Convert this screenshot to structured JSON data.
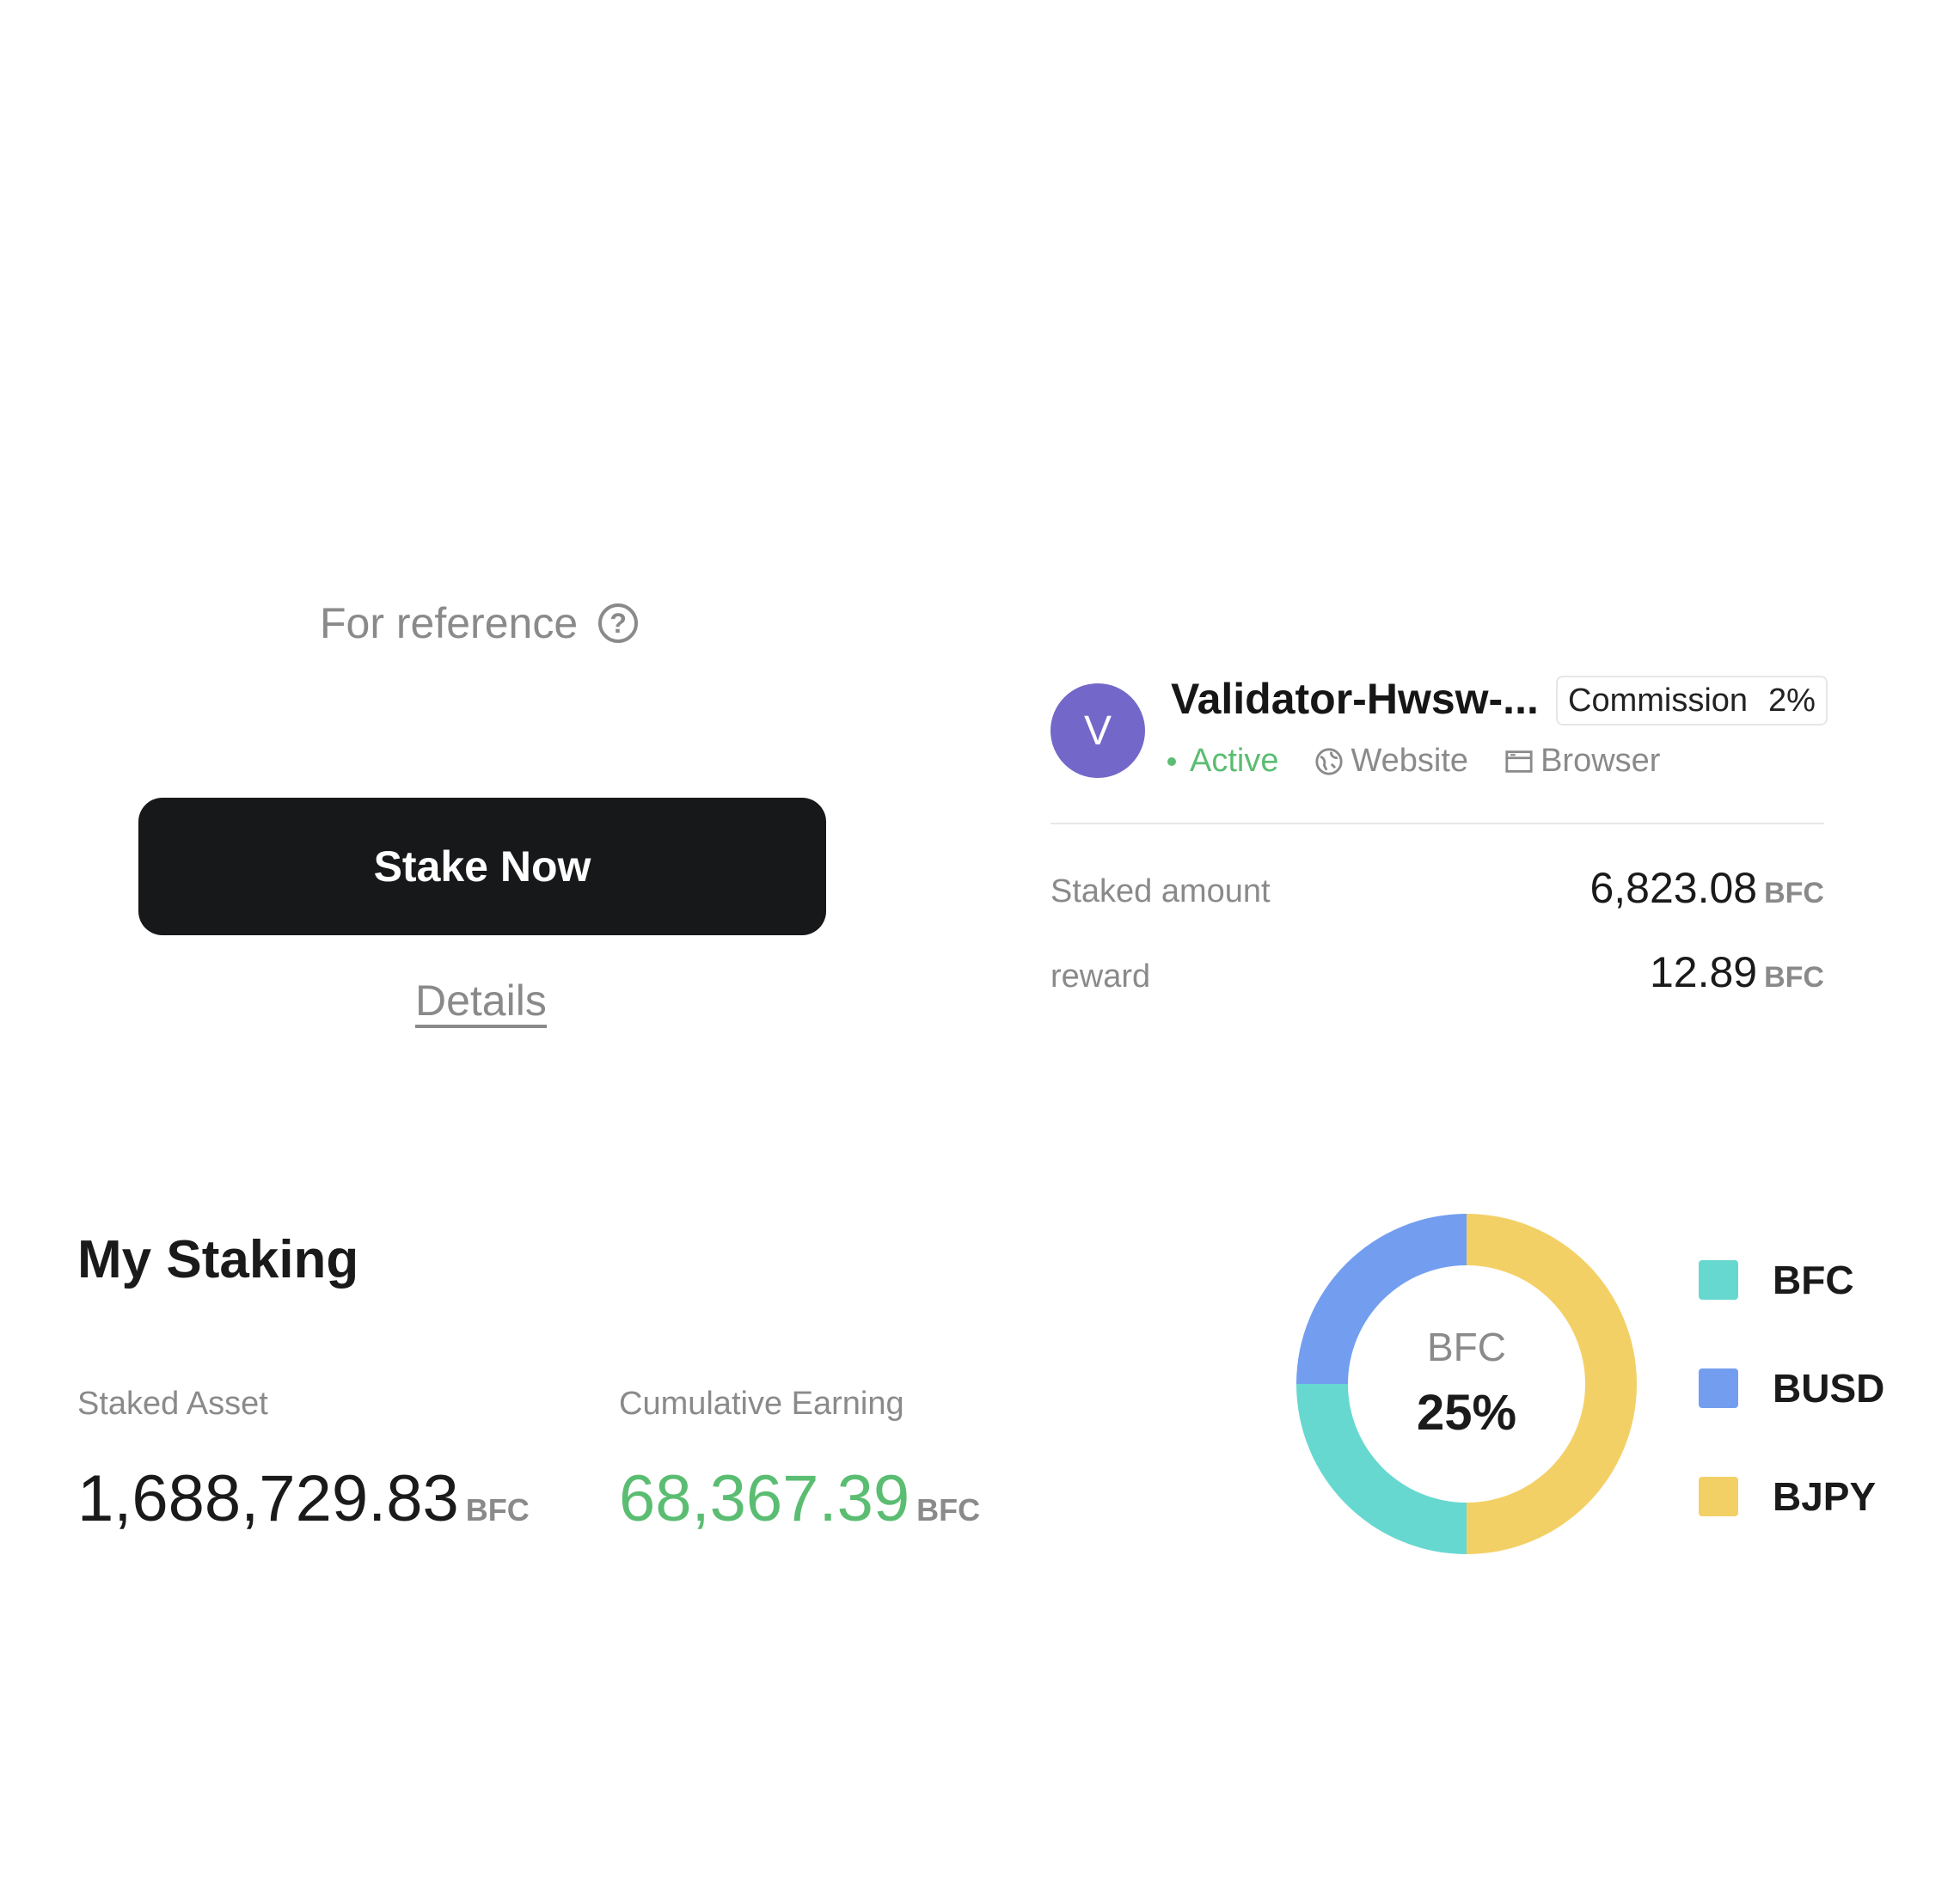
{
  "reference": {
    "text": "For reference"
  },
  "actions": {
    "stake_label": "Stake Now",
    "details_label": "Details"
  },
  "validator": {
    "avatar_letter": "V",
    "name": "Validator-Hwsw-...",
    "commission_label": "Commission",
    "commission_value": "2%",
    "status": "Active",
    "website_label": "Website",
    "browser_label": "Browser",
    "staked_amount_label": "Staked amount",
    "staked_amount_value": "6,823.08",
    "reward_label": "reward",
    "reward_value": "12.89",
    "unit": "BFC"
  },
  "my_staking": {
    "title": "My Staking",
    "staked_asset_label": "Staked Asset",
    "staked_asset_value": "1,688,729.83",
    "cumulative_label": "Cumulative Earning",
    "cumulative_value": "68,367.39",
    "unit": "BFC"
  },
  "chart_data": {
    "type": "pie",
    "center_label": "BFC",
    "center_value": "25%",
    "categories": [
      "BFC",
      "BUSD",
      "BJPY"
    ],
    "values": [
      25,
      25,
      50
    ],
    "colors": [
      "#67d8d0",
      "#739ef0",
      "#f3d066"
    ]
  },
  "colors": {
    "accent_green": "#5bbd72",
    "button_dark": "#17181a",
    "avatar": "#7367c9"
  }
}
